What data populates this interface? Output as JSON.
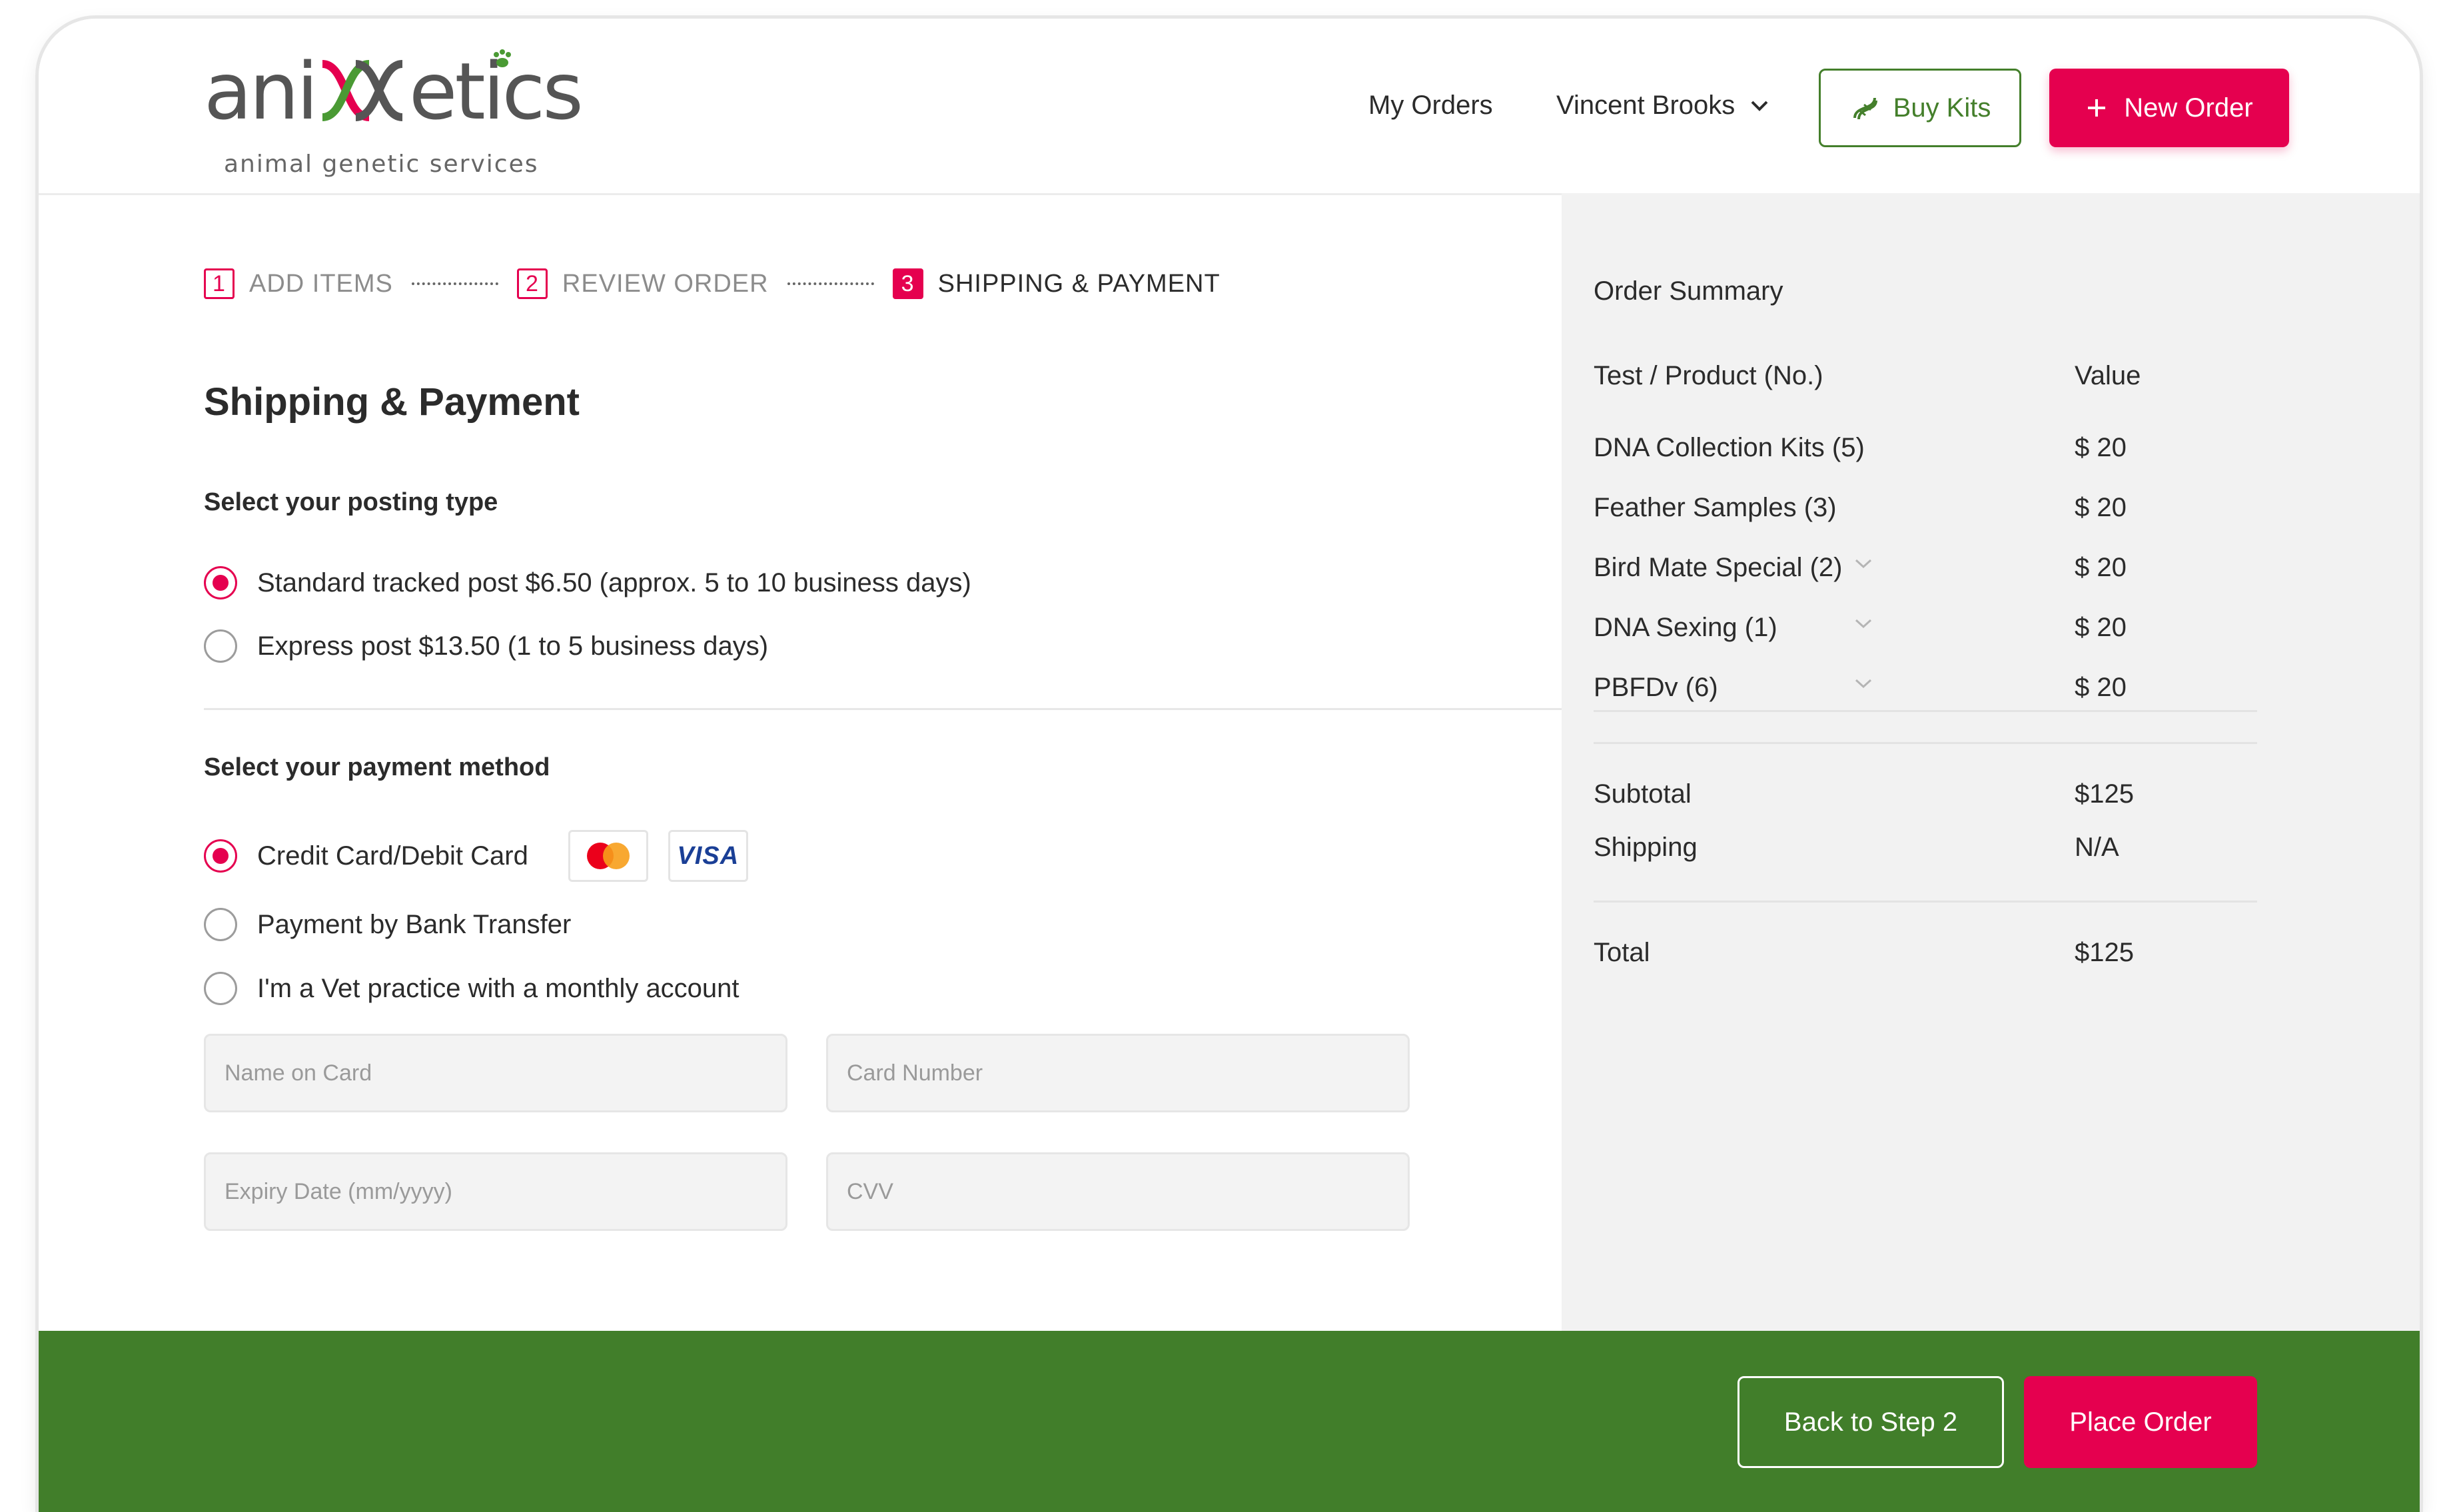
{
  "brand": {
    "name_parts": [
      "ani",
      "etics"
    ],
    "tagline": "animal genetic services"
  },
  "nav": {
    "my_orders": "My Orders",
    "user_name": "Vincent Brooks",
    "buy_kits": "Buy Kits",
    "new_order": "New Order"
  },
  "steps": [
    {
      "number": "1",
      "label": "ADD ITEMS"
    },
    {
      "number": "2",
      "label": "REVIEW ORDER"
    },
    {
      "number": "3",
      "label": "SHIPPING & PAYMENT"
    }
  ],
  "page_title": "Shipping & Payment",
  "posting": {
    "label": "Select your posting type",
    "options": [
      {
        "label": "Standard tracked post $6.50 (approx. 5 to 10 business days)",
        "selected": true
      },
      {
        "label": "Express post $13.50 (1 to 5 business days)",
        "selected": false
      }
    ]
  },
  "payment": {
    "label": "Select your payment method",
    "options": [
      {
        "label": "Credit Card/Debit Card",
        "selected": true
      },
      {
        "label": "Payment by Bank Transfer",
        "selected": false
      },
      {
        "label": "I'm a Vet practice with a monthly account",
        "selected": false
      }
    ],
    "card_logos": {
      "mastercard": "mastercard",
      "visa": "VISA"
    },
    "fields": {
      "name_placeholder": "Name on Card",
      "number_placeholder": "Card Number",
      "expiry_placeholder": "Expiry Date (mm/yyyy)",
      "cvv_placeholder": "CVV"
    }
  },
  "summary": {
    "title": "Order Summary",
    "col_product": "Test / Product (No.)",
    "col_value": "Value",
    "items": [
      {
        "name": "DNA Collection Kits (5)",
        "value": "$ 20"
      },
      {
        "name": "Feather Samples (3)",
        "value": "$ 20"
      },
      {
        "name": "Bird Mate Special (2)",
        "value": "$ 20"
      },
      {
        "name": "DNA Sexing (1)",
        "value": "$ 20"
      },
      {
        "name": "PBFDv (6)",
        "value": "$ 20"
      }
    ],
    "subtotal_label": "Subtotal",
    "subtotal_value": "$125",
    "shipping_label": "Shipping",
    "shipping_value": "N/A",
    "total_label": "Total",
    "total_value": "$125"
  },
  "footer": {
    "back_label": "Back to Step 2",
    "place_label": "Place Order"
  },
  "colors": {
    "accent": "#e5004f",
    "green": "#417e2a",
    "summary_bg": "#f2f2f2"
  }
}
